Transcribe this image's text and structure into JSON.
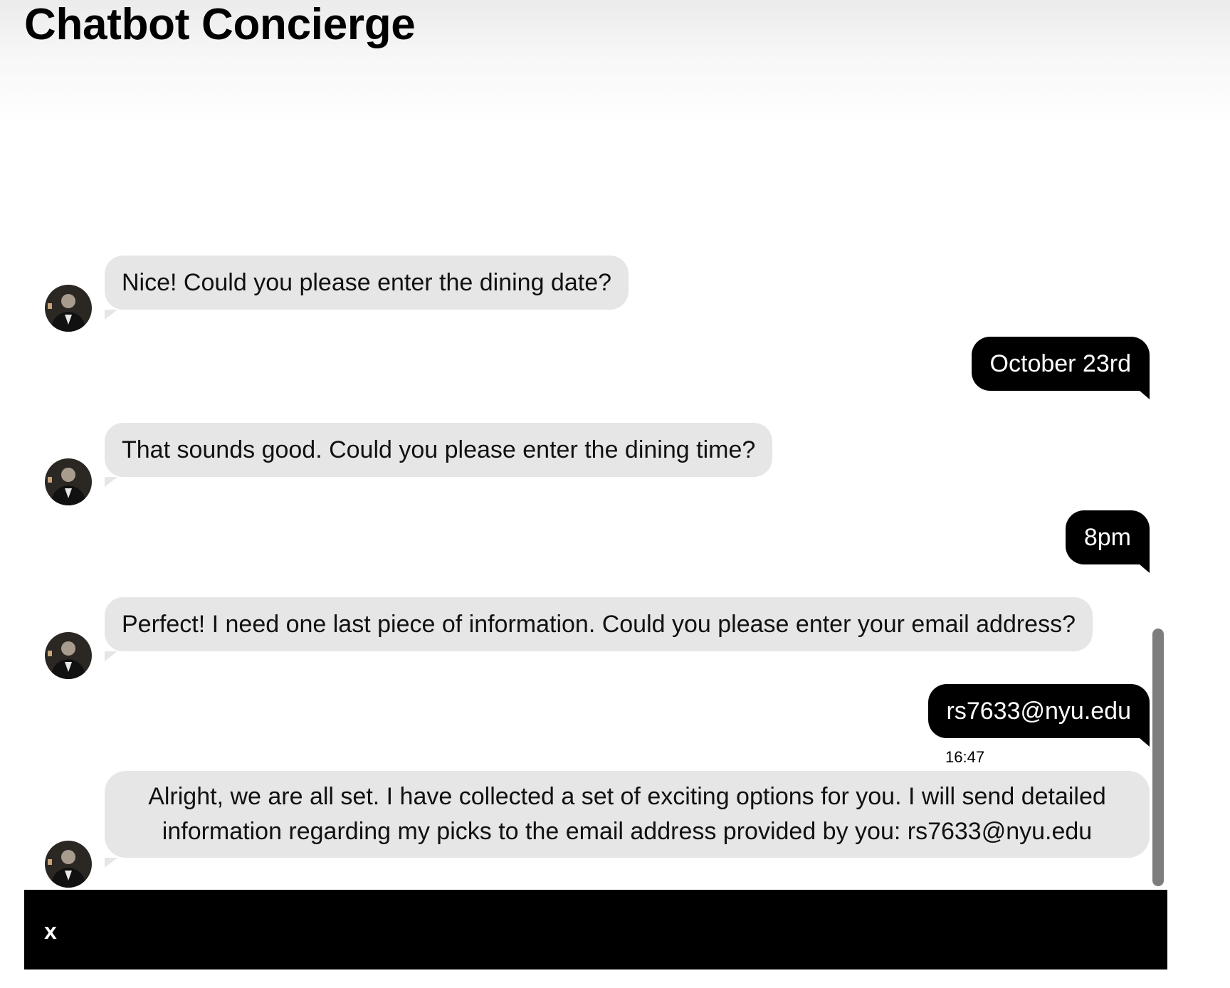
{
  "header": {
    "title": "Chatbot Concierge"
  },
  "messages": [
    {
      "sender": "bot",
      "text": "Nice! Could you please enter the dining date?"
    },
    {
      "sender": "user",
      "text": "October 23rd"
    },
    {
      "sender": "bot",
      "text": "That sounds good. Could you please enter the dining time?"
    },
    {
      "sender": "user",
      "text": "8pm"
    },
    {
      "sender": "bot",
      "text": "Perfect! I need one last piece of information. Could you please enter your email address?"
    },
    {
      "sender": "user",
      "text": "rs7633@nyu.edu",
      "timestamp": "16:47"
    },
    {
      "sender": "bot",
      "text": "Alright, we are all set. I have collected a set of exciting options for you. I will send detailed information regarding my picks to the email address provided by you: rs7633@nyu.edu"
    }
  ],
  "input_bar": {
    "close_label": "x"
  },
  "colors": {
    "bot_bubble": "#e6e6e6",
    "user_bubble": "#000000",
    "input_bar": "#000000",
    "scrollbar": "#7d7d7d"
  },
  "icons": {
    "avatar": "bot-avatar-icon",
    "close": "close-icon"
  }
}
